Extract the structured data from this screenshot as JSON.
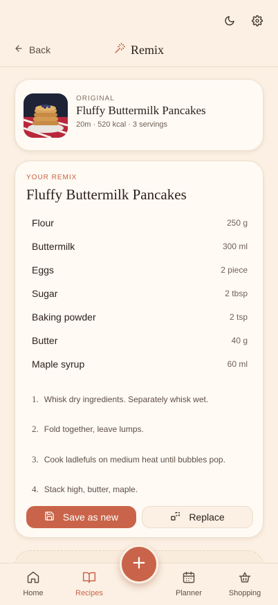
{
  "topbar": {
    "icons": [
      "moon-icon",
      "gear-icon"
    ]
  },
  "header": {
    "back_label": "Back",
    "title": "Remix",
    "title_icon": "magic-wand-icon"
  },
  "original": {
    "overline": "ORIGINAL",
    "name": "Fluffy Buttermilk Pancakes",
    "meta": "20m · 520 kcal · 3 servings"
  },
  "remix": {
    "overline": "YOUR REMIX",
    "name": "Fluffy Buttermilk Pancakes",
    "ingredients": [
      {
        "name": "Flour",
        "qty": "250 g"
      },
      {
        "name": "Buttermilk",
        "qty": "300 ml"
      },
      {
        "name": "Eggs",
        "qty": "2 piece"
      },
      {
        "name": "Sugar",
        "qty": "2 tbsp"
      },
      {
        "name": "Baking powder",
        "qty": "2 tsp"
      },
      {
        "name": "Butter",
        "qty": "40 g"
      },
      {
        "name": "Maple syrup",
        "qty": "60 ml"
      }
    ],
    "steps": [
      {
        "num": "1.",
        "text": "Whisk dry ingredients. Separately whisk wet."
      },
      {
        "num": "2.",
        "text": "Fold together, leave lumps."
      },
      {
        "num": "3.",
        "text": "Cook ladlefuls on medium heat until bubbles pop."
      },
      {
        "num": "4.",
        "text": "Stack high, butter, maple."
      }
    ],
    "save_label": "Save as new",
    "replace_label": "Replace"
  },
  "nav": {
    "items": [
      {
        "label": "Home",
        "icon": "home-icon"
      },
      {
        "label": "Recipes",
        "icon": "book-icon"
      },
      {
        "label": "Planner",
        "icon": "calendar-icon"
      },
      {
        "label": "Shopping",
        "icon": "basket-icon"
      }
    ],
    "active": "Recipes"
  },
  "colors": {
    "accent": "#c9644a",
    "background": "#fbf0e3",
    "card": "#fffaf4"
  }
}
